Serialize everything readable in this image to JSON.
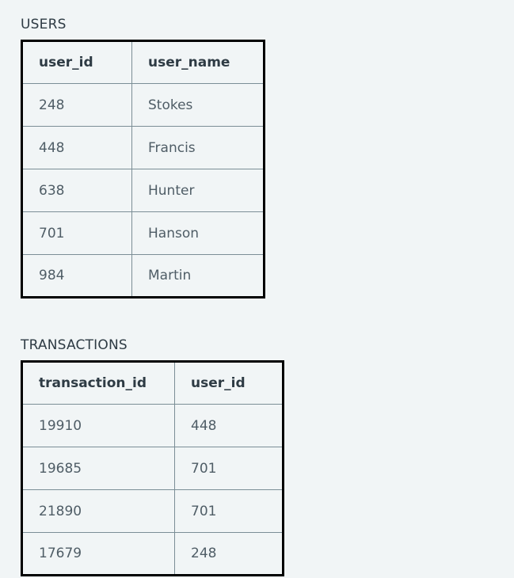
{
  "page": {
    "background_color": "#f1f5f6",
    "text_color": "#4f5d66",
    "header_text_color": "#2e3b44",
    "border_color": "#000000",
    "gridline_color": "#7b8e96"
  },
  "tables": [
    {
      "caption": "USERS",
      "columns": [
        "user_id",
        "user_name"
      ],
      "rows": [
        [
          "248",
          "Stokes"
        ],
        [
          "448",
          "Francis"
        ],
        [
          "638",
          "Hunter"
        ],
        [
          "701",
          "Hanson"
        ],
        [
          "984",
          "Martin"
        ]
      ]
    },
    {
      "caption": "TRANSACTIONS",
      "columns": [
        "transaction_id",
        "user_id"
      ],
      "rows": [
        [
          "19910",
          "448"
        ],
        [
          "19685",
          "701"
        ],
        [
          "21890",
          "701"
        ],
        [
          "17679",
          "248"
        ]
      ]
    }
  ]
}
